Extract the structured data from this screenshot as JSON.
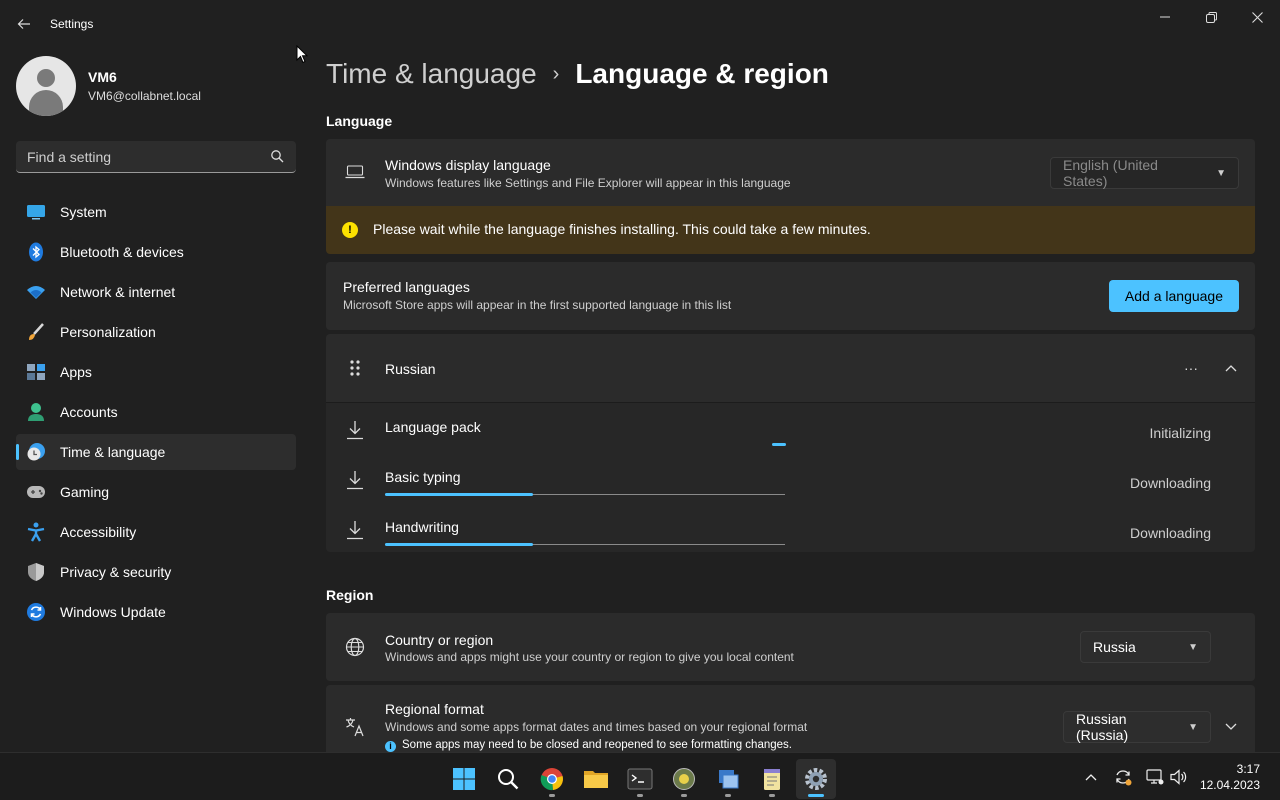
{
  "window": {
    "title": "Settings",
    "back_icon": "arrow-left-icon",
    "minimize_icon": "minimize-icon",
    "maximize_icon": "restore-icon",
    "close_icon": "close-icon"
  },
  "profile": {
    "name": "VM6",
    "email": "VM6@collabnet.local"
  },
  "search": {
    "placeholder": "Find a setting"
  },
  "sidebar": {
    "items": [
      {
        "label": "System",
        "icon": "system-icon"
      },
      {
        "label": "Bluetooth & devices",
        "icon": "bluetooth-icon"
      },
      {
        "label": "Network & internet",
        "icon": "wifi-icon"
      },
      {
        "label": "Personalization",
        "icon": "brush-icon"
      },
      {
        "label": "Apps",
        "icon": "apps-icon"
      },
      {
        "label": "Accounts",
        "icon": "accounts-icon"
      },
      {
        "label": "Time & language",
        "icon": "time-language-icon",
        "active": true
      },
      {
        "label": "Gaming",
        "icon": "gamepad-icon"
      },
      {
        "label": "Accessibility",
        "icon": "accessibility-icon"
      },
      {
        "label": "Privacy & security",
        "icon": "shield-icon"
      },
      {
        "label": "Windows Update",
        "icon": "update-icon"
      }
    ]
  },
  "breadcrumb": {
    "parent": "Time & language",
    "separator": "›",
    "current": "Language & region"
  },
  "language_section": {
    "title": "Language",
    "display_language": {
      "title": "Windows display language",
      "subtitle": "Windows features like Settings and File Explorer will appear in this language",
      "value": "English (United States)"
    },
    "warning": "Please wait while the language finishes installing. This could take a few minutes.",
    "preferred": {
      "title": "Preferred languages",
      "subtitle": "Microsoft Store apps will appear in the first supported language in this list",
      "button": "Add a language"
    },
    "language": {
      "name": "Russian",
      "more_glyph": "···",
      "features": [
        {
          "title": "Language pack",
          "status": "Initializing",
          "progress": null
        },
        {
          "title": "Basic typing",
          "status": "Downloading",
          "progress": 0.37
        },
        {
          "title": "Handwriting",
          "status": "Downloading",
          "progress": 0.37
        }
      ]
    }
  },
  "region_section": {
    "title": "Region",
    "country": {
      "title": "Country or region",
      "subtitle": "Windows and apps might use your country or region to give you local content",
      "value": "Russia"
    },
    "format": {
      "title": "Regional format",
      "subtitle": "Windows and some apps format dates and times based on your regional format",
      "note": "Some apps may need to be closed and reopened to see formatting changes.",
      "value": "Russian (Russia)"
    }
  },
  "taskbar": {
    "apps": [
      "start-icon",
      "search-icon",
      "chrome-icon",
      "file-explorer-icon",
      "terminal-icon",
      "app-icon",
      "app-icon",
      "notepad-icon",
      "settings-icon"
    ],
    "time": "3:17",
    "date": "12.04.2023"
  },
  "colors": {
    "accent": "#4cc2ff",
    "warning_bg": "#433519",
    "warning_icon": "#fce100"
  }
}
